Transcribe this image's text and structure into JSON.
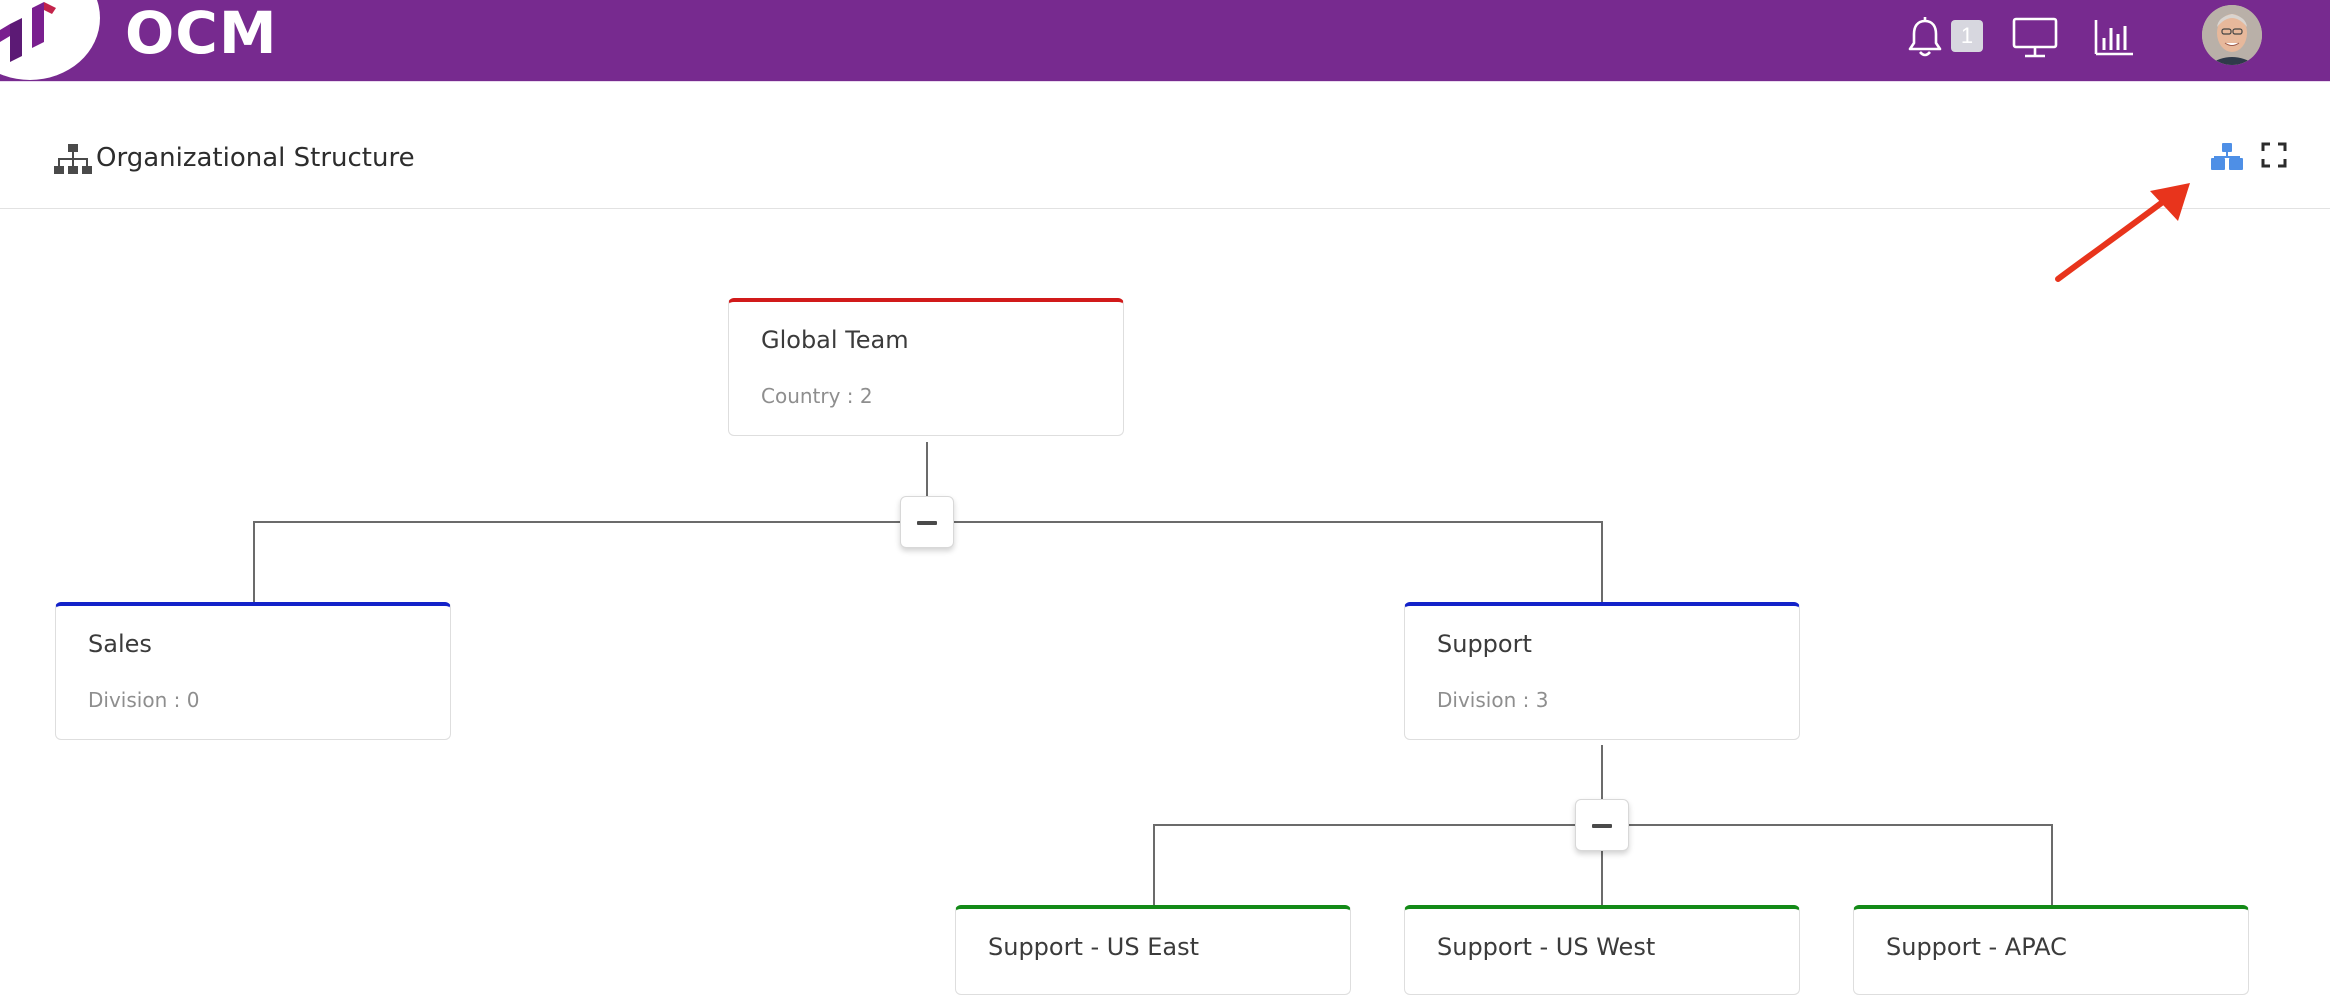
{
  "app": {
    "brand": "OCM"
  },
  "topbar": {
    "notifications_count": "1",
    "icons": [
      "bell-icon",
      "monitor-icon",
      "bar-chart-icon",
      "avatar"
    ]
  },
  "panel": {
    "title": "Organizational Structure",
    "title_icon": "sitemap-icon",
    "tools": [
      "org-chart-icon",
      "fullscreen-icon"
    ]
  },
  "colors": {
    "topbar": "#772a8f",
    "root_accent": "#d11a1a",
    "division_accent": "#1322c9",
    "subdivision_accent": "#138a17",
    "tool_accent": "#4e8fe6",
    "annotation_arrow": "#e8341c"
  },
  "org": {
    "root": {
      "title": "Global Team",
      "subtitle": "Country : 2"
    },
    "divisions": [
      {
        "title": "Sales",
        "subtitle": "Division : 0"
      },
      {
        "title": "Support",
        "subtitle": "Division : 3"
      }
    ],
    "support_children": [
      {
        "title": "Support - US East"
      },
      {
        "title": "Support - US West"
      },
      {
        "title": "Support - APAC"
      }
    ]
  }
}
